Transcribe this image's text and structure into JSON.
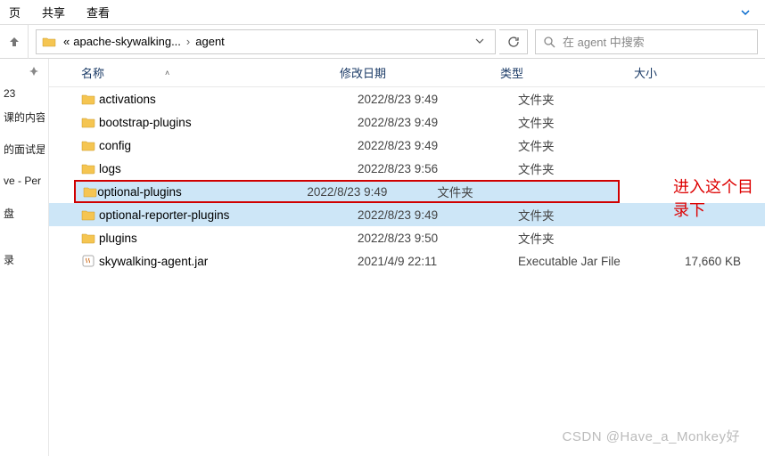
{
  "menubar": {
    "item0": "页",
    "share": "共享",
    "view": "查看"
  },
  "breadcrumb": {
    "prefix": "«",
    "root": "apache-skywalking...",
    "current": "agent"
  },
  "search": {
    "placeholder": "在 agent 中搜索"
  },
  "sidebar": {
    "items": [
      {
        "label": "23"
      },
      {
        "label": "课的内容"
      },
      {
        "label": "的面试是"
      },
      {
        "label": "ve - Per"
      },
      {
        "label": "盘"
      },
      {
        "label": "录"
      }
    ]
  },
  "columns": {
    "name": "名称",
    "date": "修改日期",
    "type": "类型",
    "size": "大小"
  },
  "files": [
    {
      "name": "activations",
      "date": "2022/8/23 9:49",
      "type": "文件夹",
      "size": "",
      "kind": "folder"
    },
    {
      "name": "bootstrap-plugins",
      "date": "2022/8/23 9:49",
      "type": "文件夹",
      "size": "",
      "kind": "folder"
    },
    {
      "name": "config",
      "date": "2022/8/23 9:49",
      "type": "文件夹",
      "size": "",
      "kind": "folder"
    },
    {
      "name": "logs",
      "date": "2022/8/23 9:56",
      "type": "文件夹",
      "size": "",
      "kind": "folder"
    },
    {
      "name": "optional-plugins",
      "date": "2022/8/23 9:49",
      "type": "文件夹",
      "size": "",
      "kind": "folder",
      "highlight": true,
      "selected": true
    },
    {
      "name": "optional-reporter-plugins",
      "date": "2022/8/23 9:49",
      "type": "文件夹",
      "size": "",
      "kind": "folder",
      "selected": true
    },
    {
      "name": "plugins",
      "date": "2022/8/23 9:50",
      "type": "文件夹",
      "size": "",
      "kind": "folder"
    },
    {
      "name": "skywalking-agent.jar",
      "date": "2021/4/9 22:11",
      "type": "Executable Jar File",
      "size": "17,660 KB",
      "kind": "jar"
    }
  ],
  "annotation": "进入这个目录下",
  "watermark": "CSDN @Have_a_Monkey好"
}
